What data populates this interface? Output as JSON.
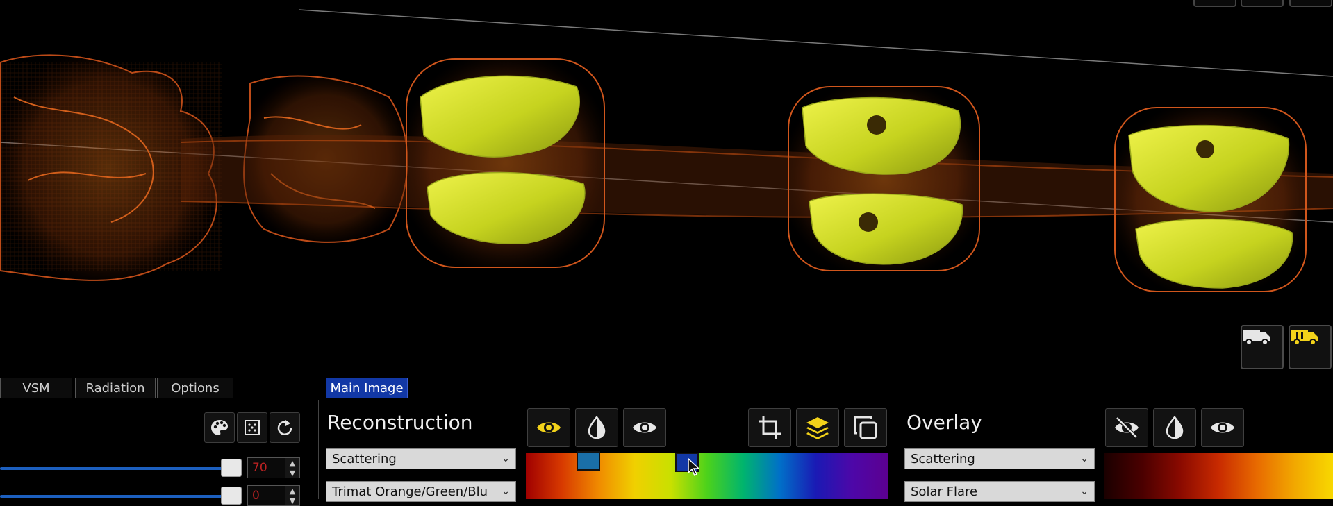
{
  "tabs": [
    {
      "label": "VSM"
    },
    {
      "label": "Radiation"
    },
    {
      "label": "Options"
    },
    {
      "label": "Main Image"
    }
  ],
  "left_panel": {
    "slider1_value": "70",
    "slider2_value": "0"
  },
  "reconstruction": {
    "title": "Reconstruction",
    "mode_select": "Scattering",
    "colormap_select": "Trimat Orange/Green/Blu"
  },
  "overlay": {
    "title": "Overlay",
    "mode_select": "Scattering",
    "colormap_select": "Solar Flare"
  },
  "icons": {
    "palette": "palette-icon",
    "grid": "grid-icon",
    "reset": "reset-icon",
    "eye_yellow": "eye-icon",
    "contrast": "contrast-icon",
    "eye": "eye-icon",
    "crop": "crop-icon",
    "layers": "layers-icon",
    "copy": "copy-icon",
    "eye_off": "eye-off-icon",
    "truck": "truck-icon",
    "truck_yellow": "truck-icon"
  },
  "colors": {
    "accent_blue": "#1238a6",
    "highlight_yellow": "#f2d21a",
    "object_orange": "#d4551a",
    "object_yellow": "#d9e030"
  }
}
